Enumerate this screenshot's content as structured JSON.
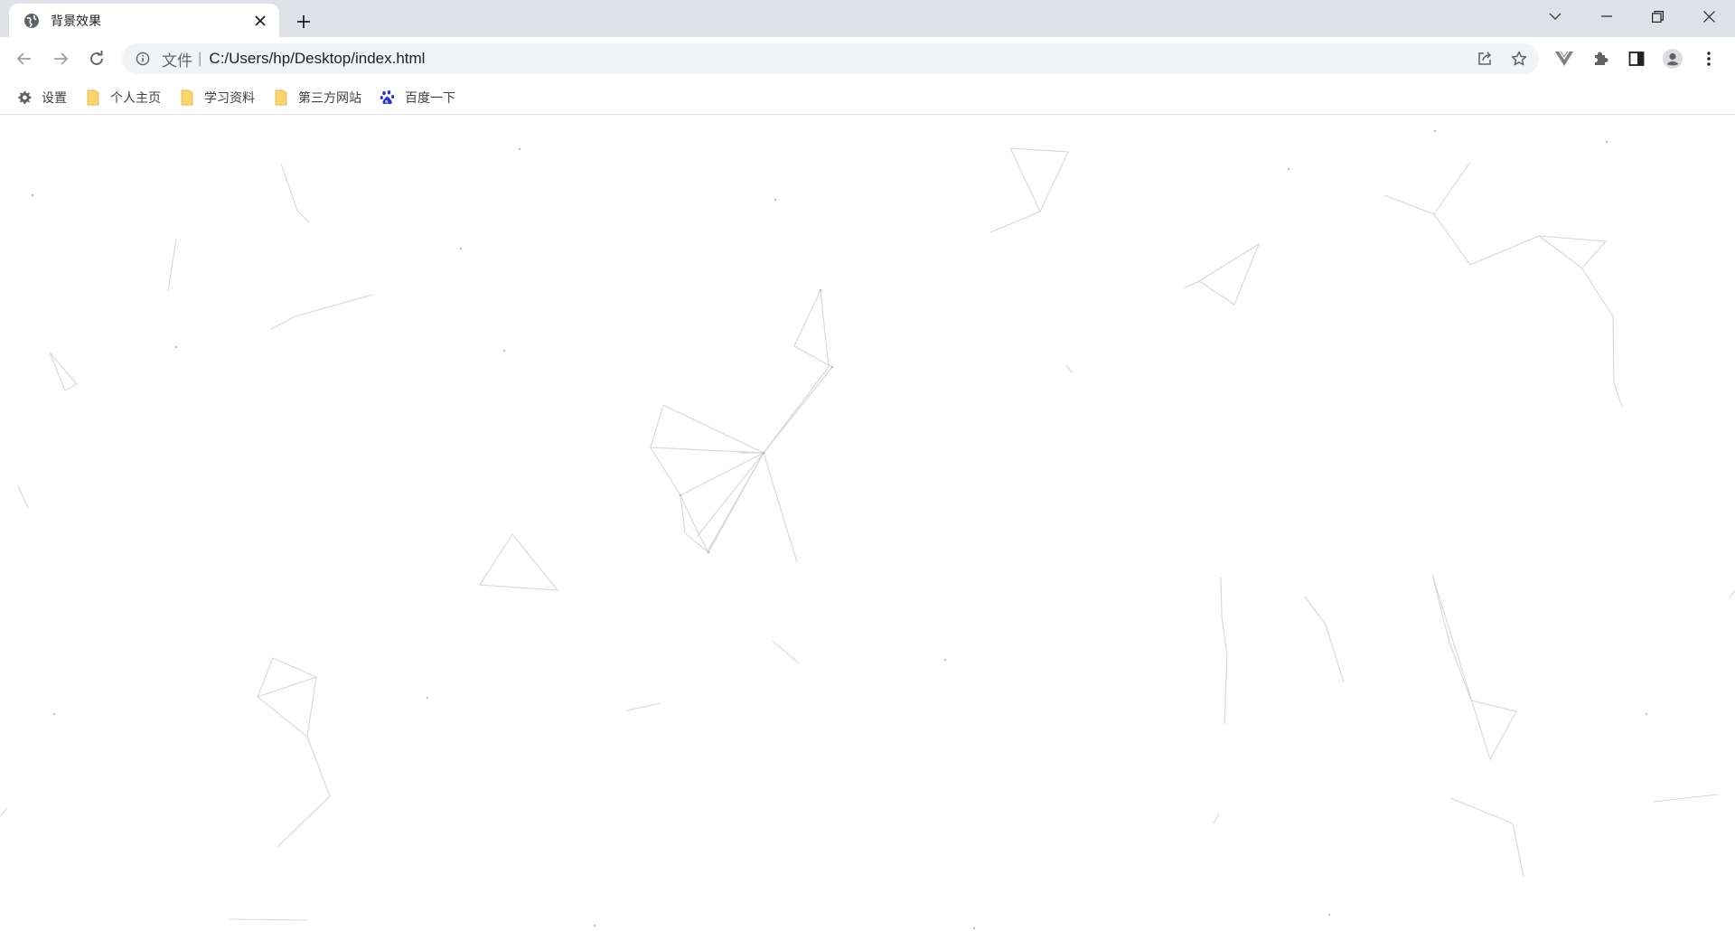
{
  "tab": {
    "title": "背景效果",
    "favicon": "globe-icon"
  },
  "toolbar": {
    "scheme_chip": "文件",
    "url": "C:/Users/hp/Desktop/index.html"
  },
  "bookmarks": [
    {
      "label": "设置",
      "icon": "gear-icon"
    },
    {
      "label": "个人主页",
      "icon": "folder-icon"
    },
    {
      "label": "学习资料",
      "icon": "folder-icon"
    },
    {
      "label": "第三方网站",
      "icon": "folder-icon"
    },
    {
      "label": "百度一下",
      "icon": "baidu-paw-icon"
    }
  ],
  "colors": {
    "tabstrip": "#dee1e6",
    "omnibox": "#f1f3f4",
    "folder": "#f9d56e",
    "baidu": "#2932e1",
    "particle_line": "#d6d6d6",
    "particle_dot": "#bdbdbd"
  }
}
